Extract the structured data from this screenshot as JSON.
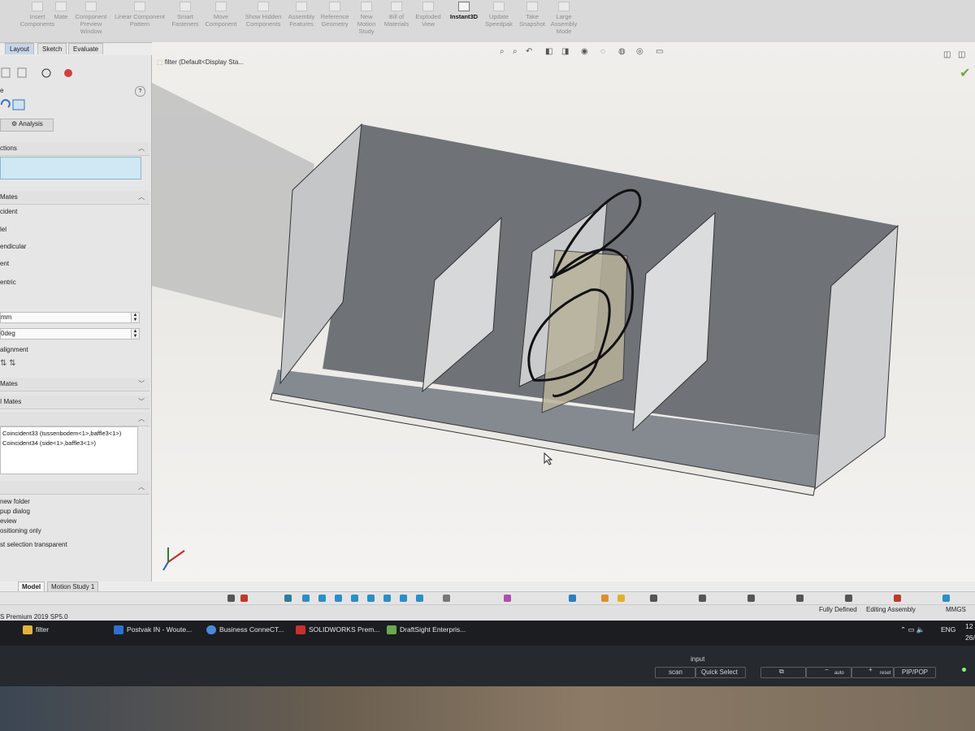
{
  "ribbon": {
    "items": [
      {
        "label": "Insert Components"
      },
      {
        "label": "Mate"
      },
      {
        "label": "Component Preview Window"
      },
      {
        "label": "Linear Component Pattern"
      },
      {
        "label": "Smart Fasteners"
      },
      {
        "label": "Move Component"
      },
      {
        "label": "Show Hidden Components"
      },
      {
        "label": "Assembly Features"
      },
      {
        "label": "Reference Geometry"
      },
      {
        "label": "New Motion Study"
      },
      {
        "label": "Bill of Materials"
      },
      {
        "label": "Exploded View"
      },
      {
        "label": "Instant3D"
      },
      {
        "label": "Update Speedpak"
      },
      {
        "label": "Take Snapshot"
      },
      {
        "label": "Large Assembly Mode"
      }
    ],
    "tabs": [
      "Layout",
      "Sketch",
      "Evaluate"
    ]
  },
  "panel": {
    "analysis_tab": "Analysis",
    "sections": {
      "selections": "ctions",
      "standard_mates": "Mates",
      "advanced_mates": "Mates",
      "mechanical_mates": "I Mates",
      "options": ""
    },
    "mate_types": [
      "cident",
      "lel",
      "endicular",
      "ent",
      "entric"
    ],
    "distance_value": "mm",
    "angle_value": "0deg",
    "alignment_label": "alignment",
    "mates_list": [
      "Coincident33 (tussenbodem<1>,baffle3<1>)",
      "Coincident34 (side<1>,baffle3<1>)"
    ],
    "options": [
      "new folder",
      "pup dialog",
      "eview",
      "ositioning only",
      "st selection transparent"
    ]
  },
  "viewport": {
    "feature_manager": "filter  (Default<Display Sta..."
  },
  "bottom_tabs": [
    "Model",
    "Motion Study 1"
  ],
  "status": {
    "version": "S Premium 2019 SP5.0",
    "fully_defined": "Fully Defined",
    "editing": "Editing Assembly",
    "units": "MMGS"
  },
  "taskbar": {
    "items": [
      {
        "label": "filter",
        "color": "#e0b43a"
      },
      {
        "label": "Postvak IN - Woute...",
        "color": "#2f6fcf"
      },
      {
        "label": "Business ConneCT...",
        "color": "#4a8ad8"
      },
      {
        "label": "SOLIDWORKS Prem...",
        "color": "#c9302c"
      },
      {
        "label": "DraftSight Enterpris...",
        "color": "#6aa84f"
      }
    ],
    "lang": "ENG",
    "time": "12",
    "date": "26/0"
  },
  "monitor": {
    "input_label": "input",
    "buttons": [
      "scan",
      "Quick Select",
      "auto",
      "reset",
      "PIP/POP"
    ]
  }
}
